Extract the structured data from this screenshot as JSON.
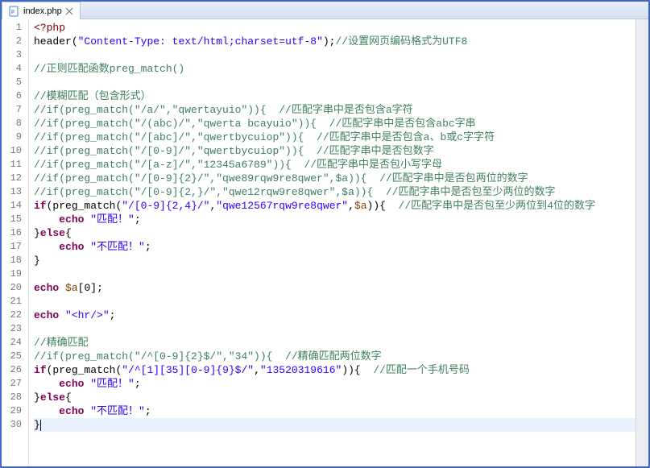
{
  "tab": {
    "title": "index.php",
    "icon": "php-file-icon",
    "close_tooltip": "Close"
  },
  "lines": [
    {
      "n": 1,
      "tokens": [
        {
          "t": "<?php",
          "c": "php"
        }
      ]
    },
    {
      "n": 2,
      "tokens": [
        {
          "t": "header",
          "c": "fn"
        },
        {
          "t": "(",
          "c": "op"
        },
        {
          "t": "\"Content-Type: text/html;charset=utf-8\"",
          "c": "str"
        },
        {
          "t": ");",
          "c": "op"
        },
        {
          "t": "//设置网页编码格式为UTF8",
          "c": "cm"
        }
      ]
    },
    {
      "n": 3,
      "tokens": []
    },
    {
      "n": 4,
      "tokens": [
        {
          "t": "//正则匹配函数preg_match()",
          "c": "cm"
        }
      ]
    },
    {
      "n": 5,
      "tokens": []
    },
    {
      "n": 6,
      "tokens": [
        {
          "t": "//模糊匹配（包含形式）",
          "c": "cm"
        }
      ]
    },
    {
      "n": 7,
      "tokens": [
        {
          "t": "//if(preg_match(\"/a/\",\"qwertayuio\")){  //匹配字串中是否包含a字符",
          "c": "cm"
        }
      ]
    },
    {
      "n": 8,
      "tokens": [
        {
          "t": "//if(preg_match(\"/(abc)/\",\"qwerta bcayuio\")){  //匹配字串中是否包含abc字串",
          "c": "cm"
        }
      ]
    },
    {
      "n": 9,
      "tokens": [
        {
          "t": "//if(preg_match(\"/[abc]/\",\"qwertbycuiop\")){  //匹配字串中是否包含a、b或c字字符",
          "c": "cm"
        }
      ]
    },
    {
      "n": 10,
      "tokens": [
        {
          "t": "//if(preg_match(\"/[0-9]/\",\"qwertbycuiop\")){  //匹配字串中是否包数字",
          "c": "cm"
        }
      ]
    },
    {
      "n": 11,
      "tokens": [
        {
          "t": "//if(preg_match(\"/[a-z]/\",\"12345a6789\")){  //匹配字串中是否包小写字母",
          "c": "cm"
        }
      ]
    },
    {
      "n": 12,
      "tokens": [
        {
          "t": "//if(preg_match(\"/[0-9]{2}/\",\"qwe89rqw9re8qwer\",$a)){  //匹配字串中是否包两位的数字",
          "c": "cm"
        }
      ]
    },
    {
      "n": 13,
      "tokens": [
        {
          "t": "//if(preg_match(\"/[0-9]{2,}/\",\"qwe12rqw9re8qwer\",$a)){  //匹配字串中是否包至少两位的数字",
          "c": "cm"
        }
      ]
    },
    {
      "n": 14,
      "tokens": [
        {
          "t": "if",
          "c": "kw"
        },
        {
          "t": "(",
          "c": "op"
        },
        {
          "t": "preg_match",
          "c": "fn"
        },
        {
          "t": "(",
          "c": "op"
        },
        {
          "t": "\"/[0-9]{2,4}/\"",
          "c": "str"
        },
        {
          "t": ",",
          "c": "op"
        },
        {
          "t": "\"qwe12567rqw9re8qwer\"",
          "c": "str"
        },
        {
          "t": ",",
          "c": "op"
        },
        {
          "t": "$a",
          "c": "var"
        },
        {
          "t": ")){  ",
          "c": "op"
        },
        {
          "t": "//匹配字串中是否包至少两位到4位的数字",
          "c": "cm"
        }
      ]
    },
    {
      "n": 15,
      "tokens": [
        {
          "t": "    ",
          "c": "op"
        },
        {
          "t": "echo",
          "c": "kw"
        },
        {
          "t": " ",
          "c": "op"
        },
        {
          "t": "\"匹配！\"",
          "c": "str"
        },
        {
          "t": ";",
          "c": "op"
        }
      ]
    },
    {
      "n": 16,
      "tokens": [
        {
          "t": "}",
          "c": "op"
        },
        {
          "t": "else",
          "c": "kw"
        },
        {
          "t": "{",
          "c": "op"
        }
      ]
    },
    {
      "n": 17,
      "tokens": [
        {
          "t": "    ",
          "c": "op"
        },
        {
          "t": "echo",
          "c": "kw"
        },
        {
          "t": " ",
          "c": "op"
        },
        {
          "t": "\"不匹配！\"",
          "c": "str"
        },
        {
          "t": ";",
          "c": "op"
        }
      ]
    },
    {
      "n": 18,
      "tokens": [
        {
          "t": "}",
          "c": "op"
        }
      ]
    },
    {
      "n": 19,
      "tokens": []
    },
    {
      "n": 20,
      "tokens": [
        {
          "t": "echo",
          "c": "kw"
        },
        {
          "t": " ",
          "c": "op"
        },
        {
          "t": "$a",
          "c": "var"
        },
        {
          "t": "[",
          "c": "op"
        },
        {
          "t": "0",
          "c": "op"
        },
        {
          "t": "];",
          "c": "op"
        }
      ]
    },
    {
      "n": 21,
      "tokens": []
    },
    {
      "n": 22,
      "tokens": [
        {
          "t": "echo",
          "c": "kw"
        },
        {
          "t": " ",
          "c": "op"
        },
        {
          "t": "\"<hr/>\"",
          "c": "str"
        },
        {
          "t": ";",
          "c": "op"
        }
      ]
    },
    {
      "n": 23,
      "tokens": []
    },
    {
      "n": 24,
      "tokens": [
        {
          "t": "//精确匹配",
          "c": "cm"
        }
      ]
    },
    {
      "n": 25,
      "tokens": [
        {
          "t": "//if(preg_match(\"/^[0-9]{2}$/\",\"34\")){  //精确匹配两位数字",
          "c": "cm"
        }
      ]
    },
    {
      "n": 26,
      "tokens": [
        {
          "t": "if",
          "c": "kw"
        },
        {
          "t": "(",
          "c": "op"
        },
        {
          "t": "preg_match",
          "c": "fn"
        },
        {
          "t": "(",
          "c": "op"
        },
        {
          "t": "\"/^[1][35][0-9]{9}$/\"",
          "c": "str"
        },
        {
          "t": ",",
          "c": "op"
        },
        {
          "t": "\"13520319616\"",
          "c": "str"
        },
        {
          "t": ")){  ",
          "c": "op"
        },
        {
          "t": "//匹配一个手机号码",
          "c": "cm"
        }
      ]
    },
    {
      "n": 27,
      "tokens": [
        {
          "t": "    ",
          "c": "op"
        },
        {
          "t": "echo",
          "c": "kw"
        },
        {
          "t": " ",
          "c": "op"
        },
        {
          "t": "\"匹配！\"",
          "c": "str"
        },
        {
          "t": ";",
          "c": "op"
        }
      ]
    },
    {
      "n": 28,
      "tokens": [
        {
          "t": "}",
          "c": "op"
        },
        {
          "t": "else",
          "c": "kw"
        },
        {
          "t": "{",
          "c": "op"
        }
      ]
    },
    {
      "n": 29,
      "tokens": [
        {
          "t": "    ",
          "c": "op"
        },
        {
          "t": "echo",
          "c": "kw"
        },
        {
          "t": " ",
          "c": "op"
        },
        {
          "t": "\"不匹配！\"",
          "c": "str"
        },
        {
          "t": ";",
          "c": "op"
        }
      ]
    },
    {
      "n": 30,
      "tokens": [
        {
          "t": "}",
          "c": "op"
        }
      ],
      "current": true,
      "cursor_after": true
    }
  ]
}
